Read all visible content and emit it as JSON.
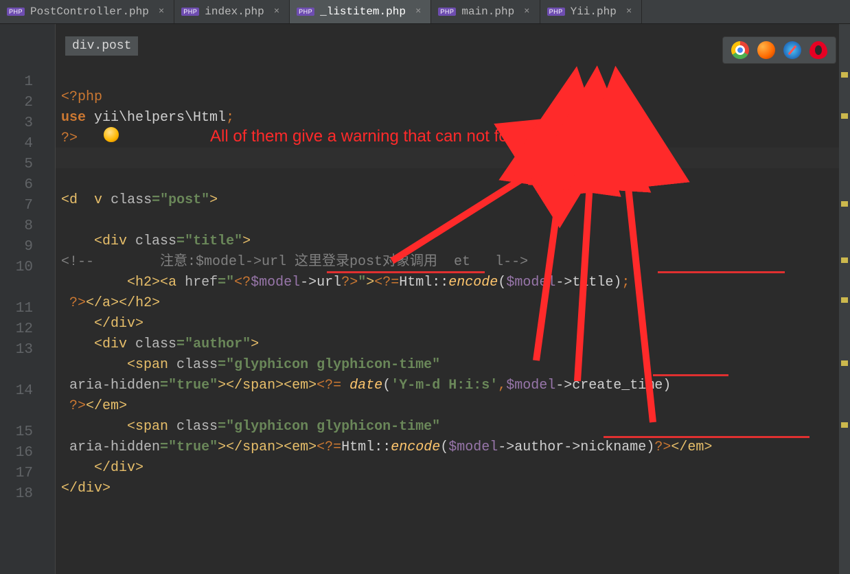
{
  "tabs": [
    {
      "label": "PostController.php",
      "active": false
    },
    {
      "label": "index.php",
      "active": false
    },
    {
      "label": "_listitem.php",
      "active": true
    },
    {
      "label": "main.php",
      "active": false
    },
    {
      "label": "Yii.php",
      "active": false
    }
  ],
  "breadcrumb": "div.post",
  "annotation": "All of them give a warning that can not found these field",
  "browser_icons": [
    "chrome",
    "firefox",
    "safari",
    "opera"
  ],
  "line_numbers": [
    "1",
    "2",
    "3",
    "4",
    "5",
    "6",
    "7",
    "8",
    "9",
    "10",
    " ",
    "11",
    "12",
    "13",
    " ",
    "14",
    " ",
    "15",
    "16",
    "17",
    "18"
  ],
  "code": {
    "l1a": "<?php",
    "l2a": "use",
    "l2b": " yii\\helpers\\Html",
    "l2c": ";",
    "l3a": "?>",
    "l6a": "<",
    "l6b": "d",
    "l6c": "v ",
    "l6d": "class",
    "l6e": "=",
    "l6f": "\"post\"",
    "l6g": ">",
    "l8a": "    <",
    "l8b": "div ",
    "l8c": "class",
    "l8d": "=",
    "l8e": "\"title\"",
    "l8f": ">",
    "l9a": "<!--        注意:$model->url 这里登录post对象调用  et   l-->",
    "l10a": "        <",
    "l10b": "h2",
    "l10c": "><",
    "l10d": "a ",
    "l10e": "href",
    "l10f": "=",
    "l10g": "\"",
    "l10h": "<?",
    "l10i": "$model",
    "l10j": "->",
    "l10k": "url",
    "l10l": "?>",
    "l10m": "\"",
    "l10n": ">",
    "l10o": "<?=",
    "l10p": "Html",
    "l10q": "::",
    "l10r": "encode",
    "l10s": "(",
    "l10t": "$model",
    "l10u": "->",
    "l10v": "title",
    "l10w": ")",
    "l10x": ";",
    "l10y": "?>",
    "l10z": "</",
    "l10z2": "a",
    "l10z3": "></",
    "l10z4": "h2",
    "l10z5": ">",
    "l11a": "    </",
    "l11b": "div",
    "l11c": ">",
    "l12a": "    <",
    "l12b": "div ",
    "l12c": "class",
    "l12d": "=",
    "l12e": "\"author\"",
    "l12f": ">",
    "l13a": "        <",
    "l13b": "span ",
    "l13c": "class",
    "l13d": "=",
    "l13e": "\"glyphicon glyphicon-time\"",
    "l13f": "aria-hidden",
    "l13g": "=",
    "l13h": "\"true\"",
    "l13i": "></",
    "l13j": "span",
    "l13k": "><",
    "l13l": "em",
    "l13m": ">",
    "l13n": "<?=",
    "l13o": " date",
    "l13p": "(",
    "l13q": "'Y-m-d H:i:s'",
    "l13r": ",",
    "l13s": "$model",
    "l13t": "->",
    "l13u": "create_time",
    "l13v": ")",
    "l13w": "?>",
    "l13x": "</",
    "l13y": "em",
    "l13z": ">",
    "l14a": "        <",
    "l14b": "span ",
    "l14c": "class",
    "l14d": "=",
    "l14e": "\"glyphicon glyphicon-time\"",
    "l14f": "aria-hidden",
    "l14g": "=",
    "l14h": "\"true\"",
    "l14i": "></",
    "l14j": "span",
    "l14k": "><",
    "l14l": "em",
    "l14m": ">",
    "l14n": "<?=",
    "l14o": "Html",
    "l14p": "::",
    "l14q": "encode",
    "l14r": "(",
    "l14s": "$model",
    "l14t": "->",
    "l14u": "author",
    "l14v": "->",
    "l14w": "nickname",
    "l14x": ")",
    "l14y": "?>",
    "l14z": "</",
    "l14z2": "em",
    "l14z3": ">",
    "l15a": "    </",
    "l15b": "div",
    "l15c": ">",
    "l16a": "</",
    "l16b": "div",
    "l16c": ">"
  }
}
